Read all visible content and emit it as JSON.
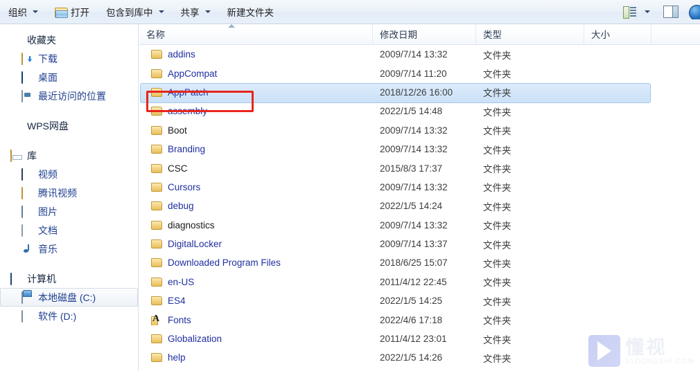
{
  "toolbar": {
    "organize": {
      "label": "组织",
      "icon": "chevron-down-icon"
    },
    "open": {
      "label": "打开",
      "icon": "open-folder-icon"
    },
    "include_in_library": {
      "label": "包含到库中",
      "icon": "chevron-down-icon"
    },
    "share": {
      "label": "共享",
      "icon": "chevron-down-icon"
    },
    "new_folder": {
      "label": "新建文件夹"
    },
    "view_mode": {
      "icon": "view-list-icon"
    },
    "view_dropdown": {
      "icon": "chevron-down-icon"
    },
    "preview_pane": {
      "icon": "preview-pane-icon"
    },
    "help": {
      "icon": "help-icon"
    }
  },
  "navpane": {
    "groups": [
      {
        "root": {
          "label": "收藏夹",
          "icon": "star-icon"
        },
        "items": [
          {
            "label": "下载",
            "icon": "download-folder-icon"
          },
          {
            "label": "桌面",
            "icon": "desktop-icon"
          },
          {
            "label": "最近访问的位置",
            "icon": "recent-places-icon"
          }
        ]
      },
      {
        "root": {
          "label": "WPS网盘",
          "icon": "cloud-icon"
        },
        "items": []
      },
      {
        "root": {
          "label": "库",
          "icon": "library-icon"
        },
        "items": [
          {
            "label": "视频",
            "icon": "video-icon"
          },
          {
            "label": "腾讯视频",
            "icon": "tencent-video-folder-icon"
          },
          {
            "label": "图片",
            "icon": "pictures-icon"
          },
          {
            "label": "文档",
            "icon": "documents-icon"
          },
          {
            "label": "音乐",
            "icon": "music-icon"
          }
        ]
      },
      {
        "root": {
          "label": "计算机",
          "icon": "computer-icon"
        },
        "items": [
          {
            "label": "本地磁盘 (C:)",
            "icon": "hard-disk-c-icon",
            "selected": true
          },
          {
            "label": "软件 (D:)",
            "icon": "hard-disk-d-icon",
            "selected": false
          }
        ]
      }
    ]
  },
  "filelist": {
    "columns": [
      {
        "key": "name",
        "label": "名称",
        "sorted": "ascending"
      },
      {
        "key": "date",
        "label": "修改日期"
      },
      {
        "key": "type",
        "label": "类型"
      },
      {
        "key": "size",
        "label": "大小"
      }
    ],
    "rows": [
      {
        "name": "addins",
        "date": "2009/7/14 13:32",
        "type": "文件夹",
        "size": "",
        "icon": "folder-icon",
        "selected": false,
        "name_color": "blue"
      },
      {
        "name": "AppCompat",
        "date": "2009/7/14 11:20",
        "type": "文件夹",
        "size": "",
        "icon": "folder-icon",
        "selected": false,
        "name_color": "blue"
      },
      {
        "name": "AppPatch",
        "date": "2018/12/26 16:00",
        "type": "文件夹",
        "size": "",
        "icon": "folder-icon",
        "selected": true,
        "name_color": "blue"
      },
      {
        "name": "assembly",
        "date": "2022/1/5 14:48",
        "type": "文件夹",
        "size": "",
        "icon": "folder-icon",
        "selected": false,
        "name_color": "blue"
      },
      {
        "name": "Boot",
        "date": "2009/7/14 13:32",
        "type": "文件夹",
        "size": "",
        "icon": "folder-icon",
        "selected": false,
        "name_color": "dark"
      },
      {
        "name": "Branding",
        "date": "2009/7/14 13:32",
        "type": "文件夹",
        "size": "",
        "icon": "folder-icon",
        "selected": false,
        "name_color": "blue"
      },
      {
        "name": "CSC",
        "date": "2015/8/3 17:37",
        "type": "文件夹",
        "size": "",
        "icon": "folder-icon",
        "selected": false,
        "name_color": "dark"
      },
      {
        "name": "Cursors",
        "date": "2009/7/14 13:32",
        "type": "文件夹",
        "size": "",
        "icon": "folder-icon",
        "selected": false,
        "name_color": "blue"
      },
      {
        "name": "debug",
        "date": "2022/1/5 14:24",
        "type": "文件夹",
        "size": "",
        "icon": "folder-icon",
        "selected": false,
        "name_color": "blue"
      },
      {
        "name": "diagnostics",
        "date": "2009/7/14 13:32",
        "type": "文件夹",
        "size": "",
        "icon": "folder-icon",
        "selected": false,
        "name_color": "dark"
      },
      {
        "name": "DigitalLocker",
        "date": "2009/7/14 13:37",
        "type": "文件夹",
        "size": "",
        "icon": "folder-icon",
        "selected": false,
        "name_color": "blue"
      },
      {
        "name": "Downloaded Program Files",
        "date": "2018/6/25 15:07",
        "type": "文件夹",
        "size": "",
        "icon": "folder-icon",
        "selected": false,
        "name_color": "blue"
      },
      {
        "name": "en-US",
        "date": "2011/4/12 22:45",
        "type": "文件夹",
        "size": "",
        "icon": "folder-icon",
        "selected": false,
        "name_color": "blue"
      },
      {
        "name": "ES4",
        "date": "2022/1/5 14:25",
        "type": "文件夹",
        "size": "",
        "icon": "folder-icon",
        "selected": false,
        "name_color": "blue"
      },
      {
        "name": "Fonts",
        "date": "2022/4/6 17:18",
        "type": "文件夹",
        "size": "",
        "icon": "fonts-folder-icon",
        "selected": false,
        "name_color": "blue"
      },
      {
        "name": "Globalization",
        "date": "2011/4/12 23:01",
        "type": "文件夹",
        "size": "",
        "icon": "folder-icon",
        "selected": false,
        "name_color": "blue"
      },
      {
        "name": "help",
        "date": "2022/1/5 14:26",
        "type": "文件夹",
        "size": "",
        "icon": "folder-icon",
        "selected": false,
        "name_color": "blue"
      }
    ]
  },
  "annotation": {
    "target_row": "AppPatch",
    "color": "#e8251c"
  },
  "watermark": {
    "cn": "懂视",
    "en": "51DONGSHI.COM"
  }
}
